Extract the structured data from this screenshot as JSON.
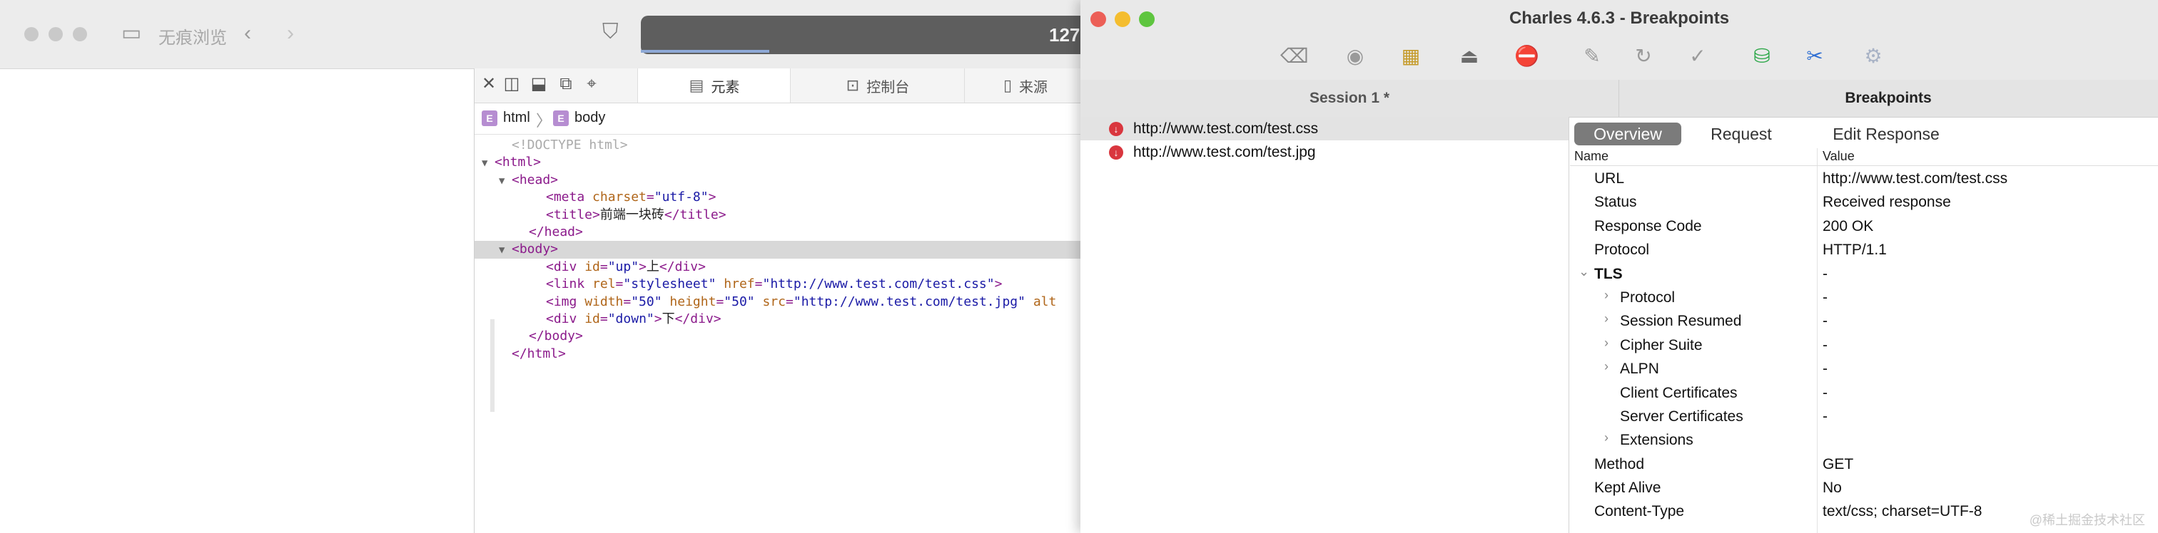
{
  "browser": {
    "private_label": "无痕浏览",
    "url_text": "127.",
    "devtools": {
      "tabs": [
        {
          "label": "元素",
          "icon": "elements-icon"
        },
        {
          "label": "控制台",
          "icon": "console-icon"
        },
        {
          "label": "来源",
          "icon": "sources-icon"
        }
      ],
      "breadcrumb": [
        {
          "badge": "E",
          "label": "html"
        },
        {
          "badge": "E",
          "label": "body"
        }
      ],
      "dom_lines": [
        {
          "indent": 1,
          "kind": "doctype",
          "text": "<!DOCTYPE html>"
        },
        {
          "indent": 0,
          "tri": "▼",
          "parts": [
            [
              "tag",
              "<html>"
            ]
          ]
        },
        {
          "indent": 1,
          "tri": "▼",
          "parts": [
            [
              "tag",
              "<head>"
            ]
          ]
        },
        {
          "indent": 3,
          "parts": [
            [
              "tag",
              "<meta "
            ],
            [
              "attr",
              "charset"
            ],
            [
              "tag",
              "="
            ],
            [
              "val",
              "\"utf-8\""
            ],
            [
              "tag",
              ">"
            ]
          ]
        },
        {
          "indent": 3,
          "parts": [
            [
              "tag",
              "<title>"
            ],
            [
              "txt",
              "前端一块砖"
            ],
            [
              "tag",
              "</title>"
            ]
          ]
        },
        {
          "indent": 2,
          "parts": [
            [
              "tag",
              "</head>"
            ]
          ]
        },
        {
          "indent": 1,
          "tri": "▼",
          "sel": true,
          "parts": [
            [
              "tag",
              "<body>"
            ]
          ]
        },
        {
          "indent": 3,
          "parts": [
            [
              "tag",
              "<div "
            ],
            [
              "attr",
              "id"
            ],
            [
              "tag",
              "="
            ],
            [
              "val",
              "\"up\""
            ],
            [
              "tag",
              ">"
            ],
            [
              "txt",
              "上"
            ],
            [
              "tag",
              "</div>"
            ]
          ]
        },
        {
          "indent": 3,
          "parts": [
            [
              "tag",
              "<link "
            ],
            [
              "attr",
              "rel"
            ],
            [
              "tag",
              "="
            ],
            [
              "val",
              "\"stylesheet\""
            ],
            [
              "tag",
              " "
            ],
            [
              "attr",
              "href"
            ],
            [
              "tag",
              "="
            ],
            [
              "val",
              "\"http://www.test.com/test.css\""
            ],
            [
              "tag",
              ">"
            ]
          ]
        },
        {
          "indent": 3,
          "parts": [
            [
              "tag",
              "<img "
            ],
            [
              "attr",
              "width"
            ],
            [
              "tag",
              "="
            ],
            [
              "val",
              "\"50\""
            ],
            [
              "tag",
              " "
            ],
            [
              "attr",
              "height"
            ],
            [
              "tag",
              "="
            ],
            [
              "val",
              "\"50\""
            ],
            [
              "tag",
              " "
            ],
            [
              "attr",
              "src"
            ],
            [
              "tag",
              "="
            ],
            [
              "val",
              "\"http://www.test.com/test.jpg\""
            ],
            [
              "tag",
              " "
            ],
            [
              "attr",
              "alt"
            ]
          ]
        },
        {
          "indent": 3,
          "parts": [
            [
              "tag",
              "<div "
            ],
            [
              "attr",
              "id"
            ],
            [
              "tag",
              "="
            ],
            [
              "val",
              "\"down\""
            ],
            [
              "tag",
              ">"
            ],
            [
              "txt",
              "下"
            ],
            [
              "tag",
              "</div>"
            ]
          ]
        },
        {
          "indent": 2,
          "parts": [
            [
              "tag",
              "</body>"
            ]
          ]
        },
        {
          "indent": 1,
          "parts": [
            [
              "tag",
              "</html>"
            ]
          ]
        }
      ]
    }
  },
  "charles": {
    "title": "Charles 4.6.3 - Breakpoints",
    "toolbar_icons": [
      "broom-icon",
      "record-icon",
      "throttle-icon",
      "turtle-icon",
      "breakpoint-icon",
      "pen-icon",
      "refresh-icon",
      "check-icon",
      "basket-icon",
      "tools-icon",
      "settings-icon"
    ],
    "tabs": {
      "session": "Session 1 *",
      "breakpoints": "Breakpoints"
    },
    "requests": [
      "http://www.test.com/test.css",
      "http://www.test.com/test.jpg"
    ],
    "detail_tabs": [
      "Overview",
      "Request",
      "Edit Response"
    ],
    "overview": {
      "headers": {
        "name": "Name",
        "value": "Value"
      },
      "rows": [
        {
          "name": "URL",
          "value": "http://www.test.com/test.css",
          "level": 0
        },
        {
          "name": "Status",
          "value": "Received response",
          "level": 0
        },
        {
          "name": "Response Code",
          "value": "200 OK",
          "level": 0
        },
        {
          "name": "Protocol",
          "value": "HTTP/1.1",
          "level": 0
        },
        {
          "name": "TLS",
          "value": "-",
          "level": 0,
          "expanded": true,
          "bold": true
        },
        {
          "name": "Protocol",
          "value": "-",
          "level": 1,
          "collapsed": true
        },
        {
          "name": "Session Resumed",
          "value": "-",
          "level": 1,
          "collapsed": true
        },
        {
          "name": "Cipher Suite",
          "value": "-",
          "level": 1,
          "collapsed": true
        },
        {
          "name": "ALPN",
          "value": "-",
          "level": 1,
          "collapsed": true
        },
        {
          "name": "Client Certificates",
          "value": "-",
          "level": 1
        },
        {
          "name": "Server Certificates",
          "value": "-",
          "level": 1
        },
        {
          "name": "Extensions",
          "value": "",
          "level": 1,
          "collapsed": true
        },
        {
          "name": "Method",
          "value": "GET",
          "level": 0
        },
        {
          "name": "Kept Alive",
          "value": "No",
          "level": 0
        },
        {
          "name": "Content-Type",
          "value": "text/css; charset=UTF-8",
          "level": 0
        }
      ]
    }
  },
  "watermark": "@稀土掘金技术社区"
}
